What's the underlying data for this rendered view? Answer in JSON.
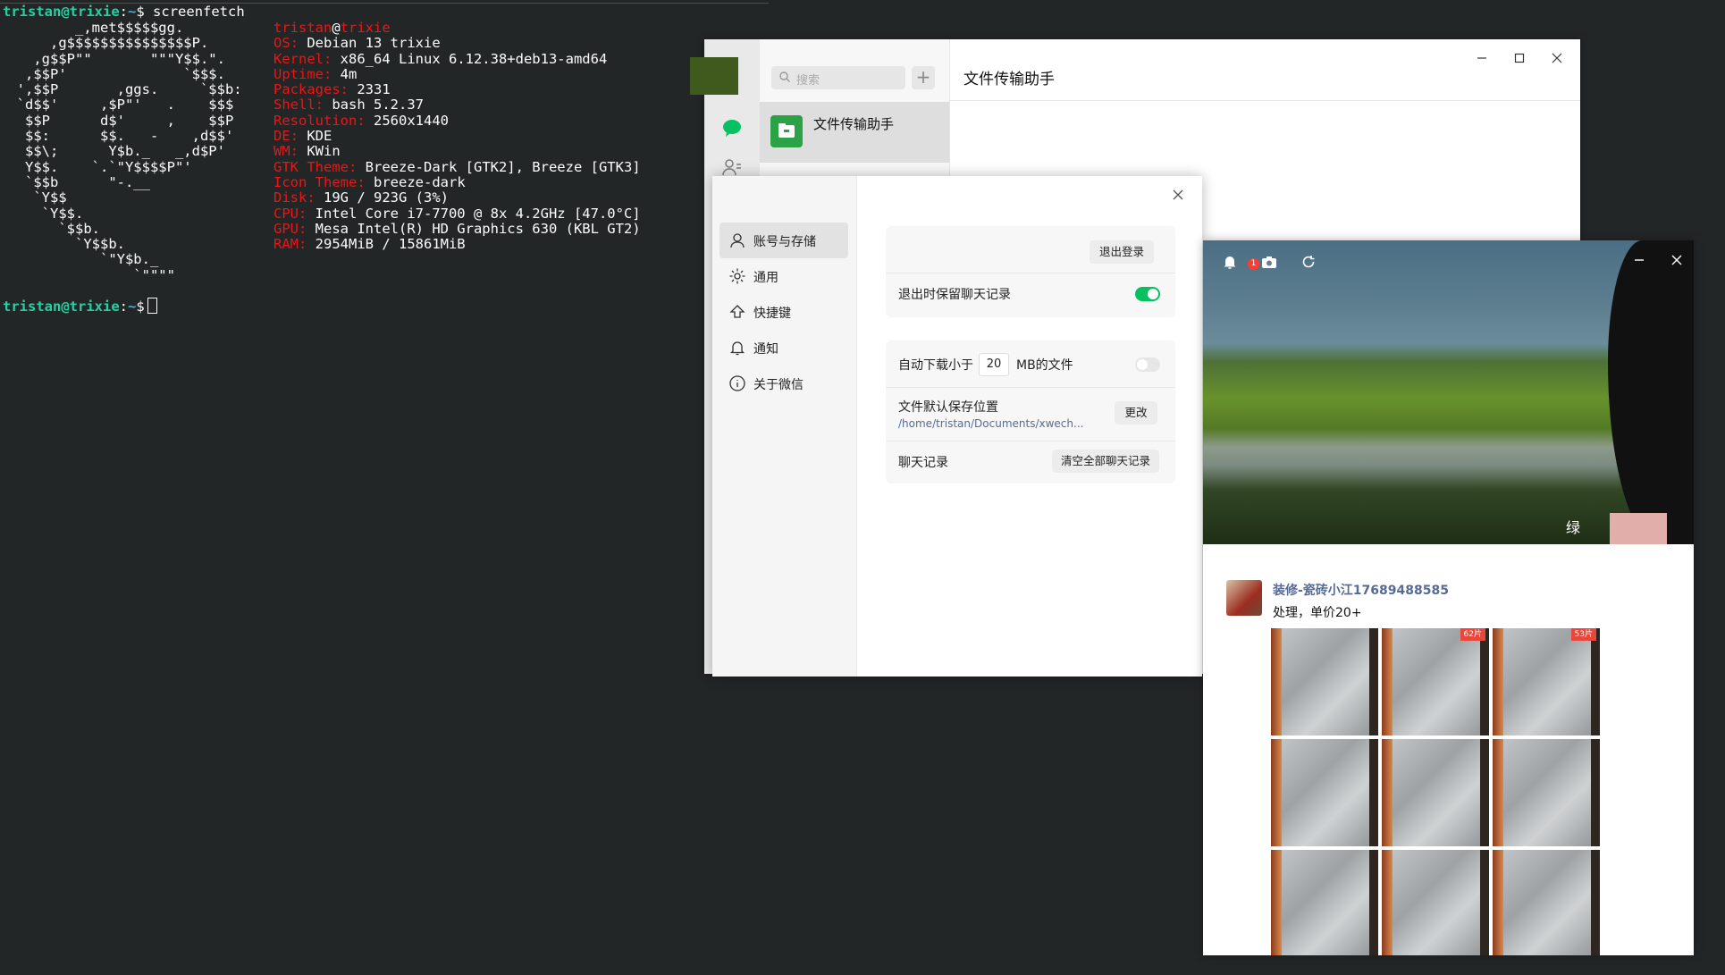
{
  "terminal": {
    "prompt_user": "tristan@trixie",
    "prompt_sep": ":",
    "prompt_path": "~",
    "prompt_symbol": "$",
    "command": "screenfetch",
    "logo_lines": [
      "         _,met$$$$$gg.",
      "      ,g$$$$$$$$$$$$$$$P.",
      "    ,g$$P\"\"       \"\"\"Y$$.\".",
      "   ,$$P'              `$$$.",
      "  ',$$P       ,ggs.     `$$b:",
      "  `d$$'     ,$P\"'   .    $$$",
      "   $$P      d$'     ,    $$P",
      "   $$:      $$.   -    ,d$$'",
      "   $$\\;      Y$b._   _,d$P'",
      "   Y$$.    `.`\"Y$$$$P\"'",
      "   `$$b      \"-.__",
      "    `Y$$",
      "     `Y$$.",
      "       `$$b.",
      "         `Y$$b.",
      "            `\"Y$b._",
      "                `\"\"\"\""
    ],
    "host": {
      "user": "tristan",
      "at": "@",
      "name": "trixie"
    },
    "info": [
      {
        "key": "OS:",
        "value": "Debian 13 trixie"
      },
      {
        "key": "Kernel:",
        "value": "x86_64 Linux 6.12.38+deb13-amd64"
      },
      {
        "key": "Uptime:",
        "value": "4m"
      },
      {
        "key": "Packages:",
        "value": "2331"
      },
      {
        "key": "Shell:",
        "value": "bash 5.2.37"
      },
      {
        "key": "Resolution:",
        "value": "2560x1440"
      },
      {
        "key": "DE:",
        "value": "KDE"
      },
      {
        "key": "WM:",
        "value": "KWin"
      },
      {
        "key": "GTK Theme:",
        "value": "Breeze-Dark [GTK2], Breeze [GTK3]"
      },
      {
        "key": "Icon Theme:",
        "value": "breeze-dark"
      },
      {
        "key": "Disk:",
        "value": "19G / 923G (3%)"
      },
      {
        "key": "CPU:",
        "value": "Intel Core i7-7700 @ 8x 4.2GHz [47.0°C]"
      },
      {
        "key": "GPU:",
        "value": "Mesa Intel(R) HD Graphics 630 (KBL GT2)"
      },
      {
        "key": "RAM:",
        "value": "2954MiB / 15861MiB"
      }
    ]
  },
  "wechat": {
    "search_placeholder": "搜索",
    "add_label": "+",
    "conversation_name": "文件传输助手",
    "chat_title": "文件传输助手",
    "accent": "#07c160"
  },
  "settings": {
    "sidebar": [
      {
        "label": "账号与存储",
        "icon": "user-icon",
        "active": true
      },
      {
        "label": "通用",
        "icon": "gear-icon",
        "active": false
      },
      {
        "label": "快捷键",
        "icon": "shortcut-icon",
        "active": false
      },
      {
        "label": "通知",
        "icon": "bell-icon",
        "active": false
      },
      {
        "label": "关于微信",
        "icon": "info-icon",
        "active": false
      }
    ],
    "logout_label": "退出登录",
    "keep_history_label": "退出时保留聊天记录",
    "keep_history_on": true,
    "auto_download_prefix": "自动下载小于",
    "auto_download_value": "20",
    "auto_download_suffix": "MB的文件",
    "auto_download_on": false,
    "save_location_label": "文件默认保存位置",
    "save_location_path": "/home/tristan/Documents/xwech...",
    "change_label": "更改",
    "chat_history_label": "聊天记录",
    "clear_history_label": "清空全部聊天记录"
  },
  "moments": {
    "notification_count": "1",
    "author": "装修-瓷砖小江17689488585",
    "text": "处理，单价20+",
    "photo_overlay_char": "绿",
    "tiles": [
      {
        "tag": ""
      },
      {
        "tag": "62片"
      },
      {
        "tag": "53片"
      },
      {
        "tag": ""
      },
      {
        "tag": ""
      },
      {
        "tag": ""
      },
      {
        "tag": ""
      },
      {
        "tag": ""
      },
      {
        "tag": ""
      }
    ]
  }
}
